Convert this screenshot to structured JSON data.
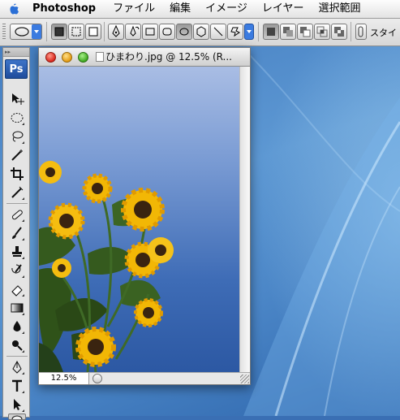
{
  "menubar": {
    "app_name": "Photoshop",
    "items": [
      "ファイル",
      "編集",
      "イメージ",
      "レイヤー",
      "選択範囲"
    ]
  },
  "options_bar": {
    "truncated_label": "スタイ"
  },
  "tools": {
    "logo": "Ps"
  },
  "document": {
    "title": "ひまわり.jpg @ 12.5% (R...",
    "zoom": "12.5%"
  },
  "colors": {
    "accent": "#2f6fd0",
    "sky_top": "#a9bde4",
    "sky_bottom": "#2c58a3",
    "petal": "#f2b705"
  }
}
